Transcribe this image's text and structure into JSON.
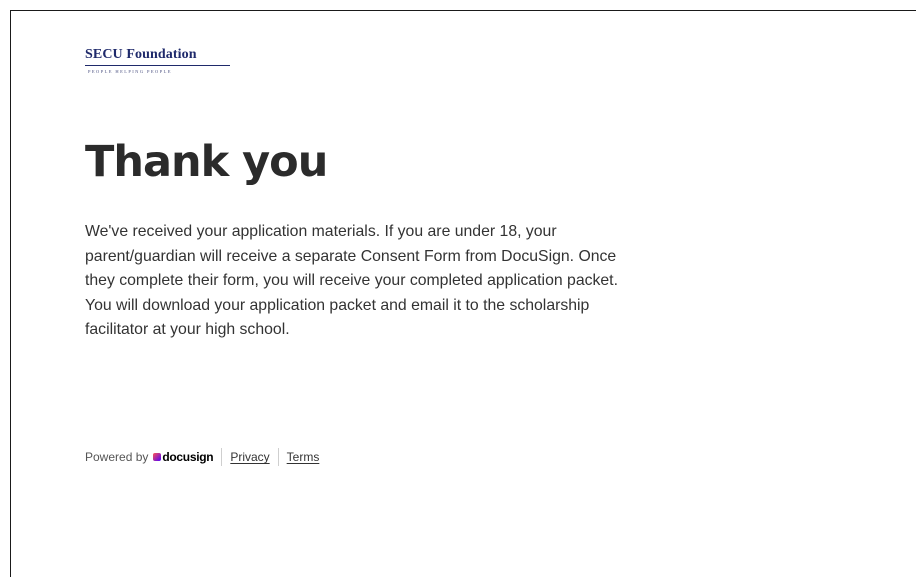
{
  "logo": {
    "title": "SECU Foundation",
    "tagline": "PEOPLE HELPING PEOPLE"
  },
  "page": {
    "heading": "Thank you",
    "message_lines": [
      "We've received your application materials. If you are under 18, your",
      "parent/guardian will receive a separate Consent Form from DocuSign. Once",
      "they complete their form, you will receive your completed application packet.",
      "You will download your application packet and email it to the scholarship",
      "facilitator at your high school."
    ]
  },
  "footer": {
    "powered_by": "Powered by",
    "brand": "docusign",
    "privacy_label": "Privacy",
    "terms_label": "Terms"
  },
  "colors": {
    "logo": "#1f2a6b",
    "heading": "#2b2b2b",
    "text": "#333333"
  }
}
